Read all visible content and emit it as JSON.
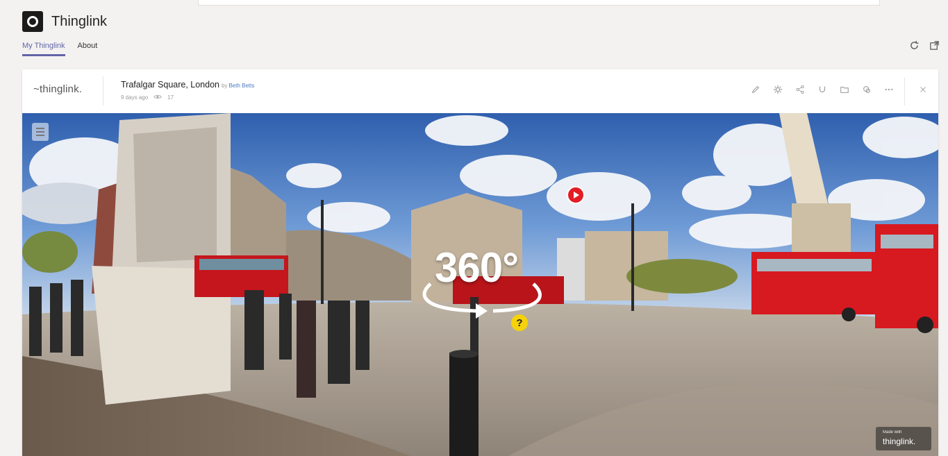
{
  "app": {
    "title": "Thinglink"
  },
  "tabs": [
    {
      "label": "My Thinglink",
      "active": true
    },
    {
      "label": "About",
      "active": false
    }
  ],
  "top_actions": [
    {
      "icon": "refresh-icon"
    },
    {
      "icon": "open-external-icon"
    }
  ],
  "card": {
    "brand": "~thinglink.",
    "title": "Trafalgar Square, London",
    "by_label": "by",
    "author": "Beth Betts",
    "time_ago": "9 days ago",
    "views": "17",
    "toolbar": [
      {
        "icon": "edit-icon"
      },
      {
        "icon": "settings-icon"
      },
      {
        "icon": "share-icon"
      },
      {
        "icon": "tag-icon"
      },
      {
        "icon": "folder-icon"
      },
      {
        "icon": "copy-icon"
      },
      {
        "icon": "more-icon"
      },
      {
        "icon": "close-icon"
      }
    ]
  },
  "viewer": {
    "badge_text": "360°",
    "hotspot_question": "?",
    "made_with_label": "Made with",
    "made_with_brand": "thinglink."
  },
  "colors": {
    "accent": "#6264a7",
    "hotspot_video": "#e41d25",
    "hotspot_question": "#f5d20a",
    "author_link": "#4a78c2"
  }
}
